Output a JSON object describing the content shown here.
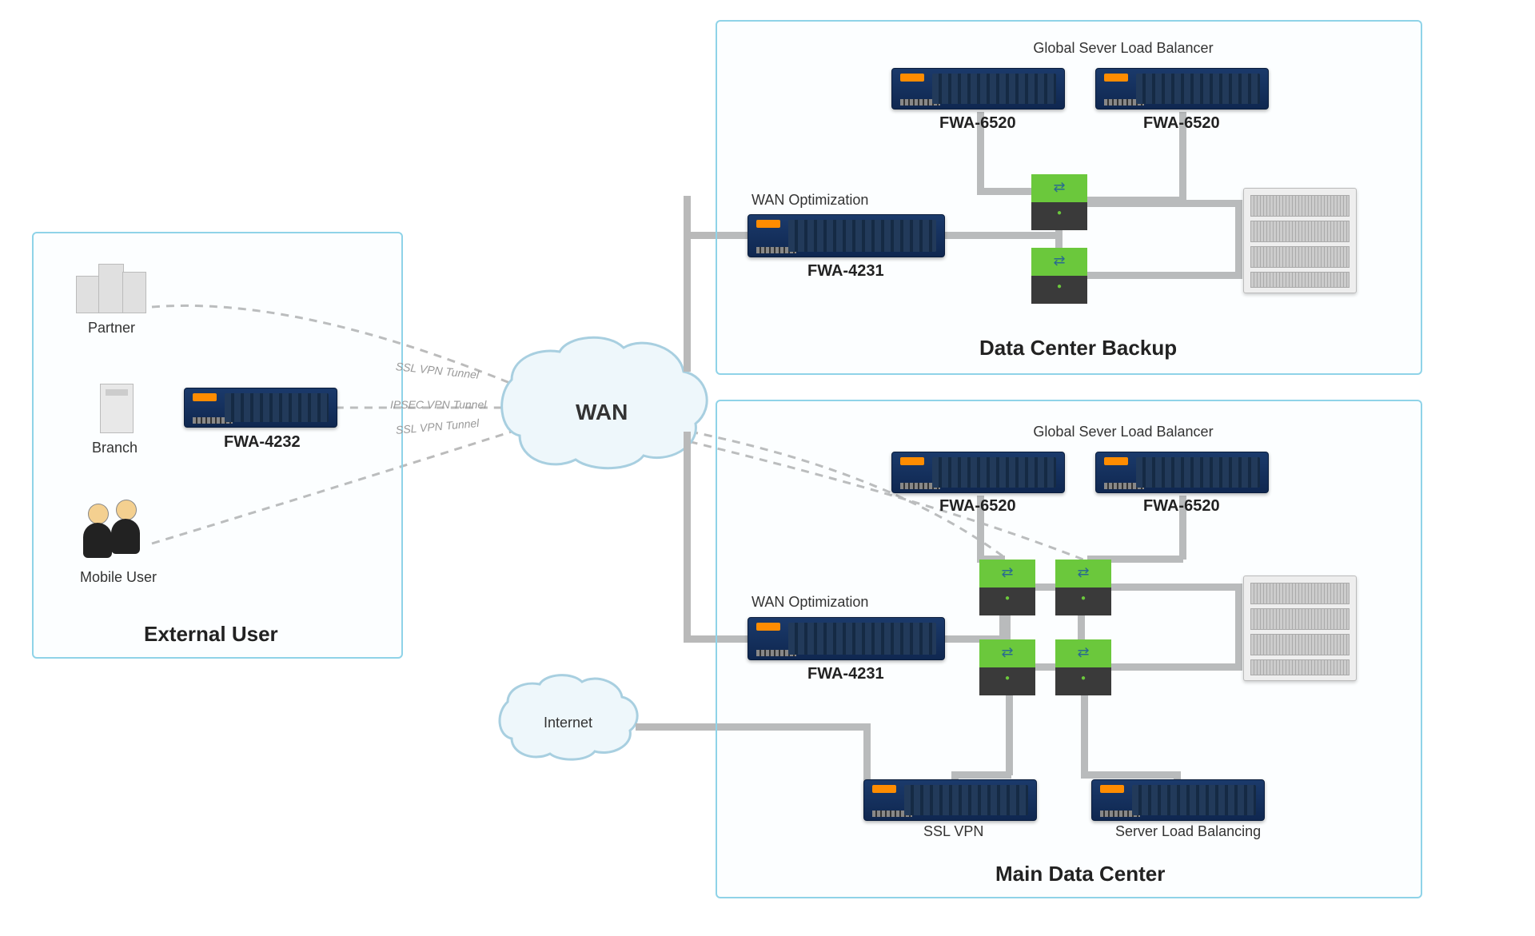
{
  "zones": {
    "external": "External User",
    "backup": "Data Center Backup",
    "main": "Main Data Center"
  },
  "external": {
    "partner": "Partner",
    "branch": "Branch",
    "mobile": "Mobile User",
    "appliance": "FWA-4232"
  },
  "tunnels": {
    "t1": "SSL VPN Tunnel",
    "t2": "IPSEC VPN Tunnel",
    "t3": "SSL VPN Tunnel"
  },
  "wan": "WAN",
  "internet": "Internet",
  "backup": {
    "gslb_title": "Global Sever Load Balancer",
    "gslb1": "FWA-6520",
    "gslb2": "FWA-6520",
    "wanopt_title": "WAN Optimization",
    "wanopt": "FWA-4231"
  },
  "main": {
    "gslb_title": "Global Sever Load Balancer",
    "gslb1": "FWA-6520",
    "gslb2": "FWA-6520",
    "wanopt_title": "WAN Optimization",
    "wanopt": "FWA-4231",
    "sslvpn": "SSL VPN",
    "slb": "Server Load Balancing"
  }
}
